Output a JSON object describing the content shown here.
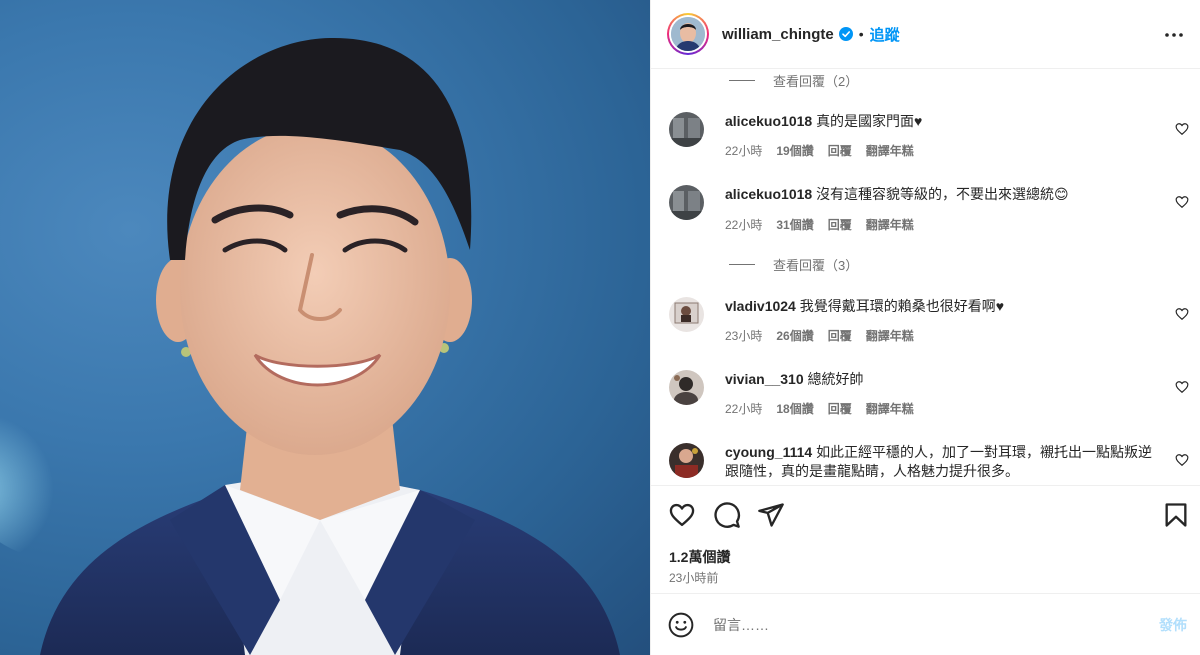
{
  "header": {
    "username": "william_chingte",
    "separator": "•",
    "follow_label": "追蹤"
  },
  "comments_section": {
    "view_replies_1": "查看回覆（2）",
    "view_replies_2": "查看回覆（3）",
    "comments": [
      {
        "user": "alicekuo1018",
        "text": "真的是國家門面♥",
        "time": "22小時",
        "likes": "19個讚",
        "reply": "回覆",
        "translate": "翻譯年糕"
      },
      {
        "user": "alicekuo1018",
        "text": "沒有這種容貌等級的，不要出來選總統😊",
        "time": "22小時",
        "likes": "31個讚",
        "reply": "回覆",
        "translate": "翻譯年糕"
      },
      {
        "user": "vladiv1024",
        "text": "我覺得戴耳環的賴桑也很好看啊♥",
        "time": "23小時",
        "likes": "26個讚",
        "reply": "回覆",
        "translate": "翻譯年糕"
      },
      {
        "user": "vivian__310",
        "text": "總統好帥",
        "time": "22小時",
        "likes": "18個讚",
        "reply": "回覆",
        "translate": "翻譯年糕"
      },
      {
        "user": "cyoung_1114",
        "text": "如此正經平穩的人，加了一對耳環，襯托出一點點叛逆跟隨性，真的是畫龍點睛，人格魅力提升很多。"
      }
    ]
  },
  "post": {
    "likes": "1.2萬個讚",
    "time_ago": "23小時前"
  },
  "comment_box": {
    "placeholder": "留言……",
    "post_label": "發佈"
  },
  "icons": {
    "verified": "verified-badge-icon",
    "more": "more-options-icon",
    "like": "heart-icon",
    "comment": "comment-bubble-icon",
    "share": "paper-plane-icon",
    "save": "bookmark-icon",
    "emoji": "smiley-icon"
  },
  "colors": {
    "accent": "#0095f6",
    "post_button_disabled": "#b2dffc",
    "secondary_text": "#737373"
  }
}
